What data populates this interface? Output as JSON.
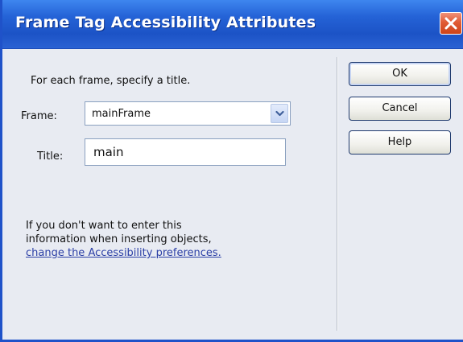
{
  "window": {
    "title": "Frame Tag Accessibility Attributes"
  },
  "form": {
    "instructions": "For each frame, specify a title.",
    "frame_label": "Frame:",
    "frame_value": "mainFrame",
    "title_label": "Title:",
    "title_value": "main"
  },
  "info": {
    "line1": "If you don't want to enter this",
    "line2": "information when inserting objects,",
    "link": "change the Accessibility preferences."
  },
  "buttons": {
    "ok": "OK",
    "cancel": "Cancel",
    "help": "Help"
  },
  "colors": {
    "titlebar": "#2462d6",
    "close": "#e05b34",
    "link": "#2b3fa6"
  },
  "icons": {
    "close": "close-icon",
    "dropdown": "chevron-down-icon"
  }
}
